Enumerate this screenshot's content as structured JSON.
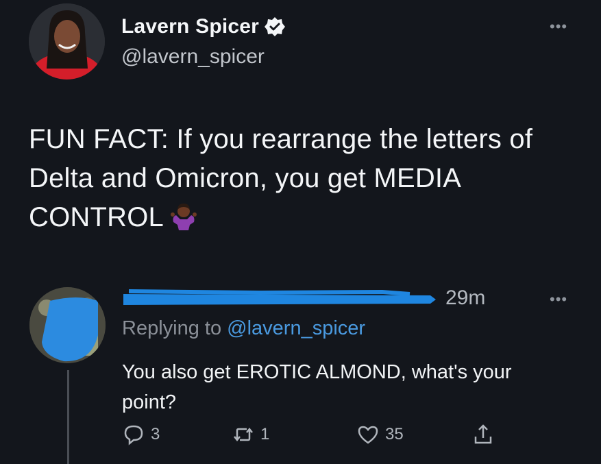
{
  "tweet": {
    "author_name": "Lavern Spicer",
    "author_handle": "@lavern_spicer",
    "text": "FUN FACT: If you rearrange the letters of Delta and Omicron, you get MEDIA CONTROL",
    "emoji_icon": "person-shrugging-icon"
  },
  "reply": {
    "timestamp": "29m",
    "replying_prefix": "Replying to ",
    "replying_to": "@lavern_spicer",
    "text": "You also get EROTIC ALMOND, what's your point?",
    "actions": {
      "replies": "3",
      "retweets": "1",
      "likes": "35"
    }
  },
  "colors": {
    "background": "#13161c",
    "link": "#4a9ae0",
    "redaction": "#1f86e0"
  }
}
